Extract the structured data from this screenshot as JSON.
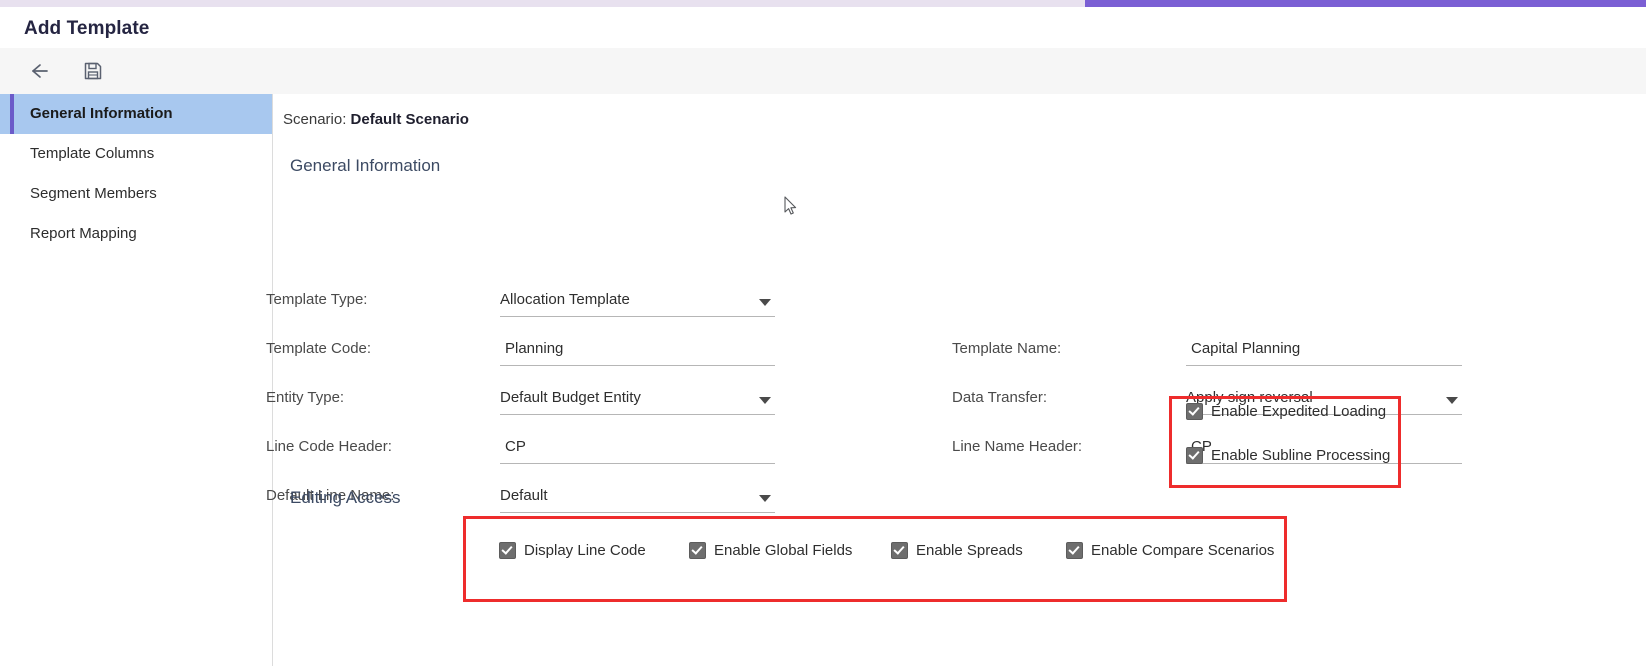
{
  "window": {
    "title": "Add Template",
    "accent_color": "#7b5fd4"
  },
  "toolbar": {
    "back_label": "Back",
    "save_label": "Save",
    "icons": [
      "back-arrow-icon",
      "save-floppy-icon"
    ]
  },
  "sidebar": {
    "items": [
      {
        "label": "General Information",
        "selected": true
      },
      {
        "label": "Template Columns",
        "selected": false
      },
      {
        "label": "Segment Members",
        "selected": false
      },
      {
        "label": "Report Mapping",
        "selected": false
      }
    ],
    "selected_bg": "#a8c8ef",
    "accent_bar": "#6b5bc9"
  },
  "main": {
    "scenario": {
      "label": "Scenario:",
      "value": "Default Scenario"
    },
    "general_information": {
      "heading": "General Information",
      "fields_left": [
        {
          "label": "Template Type:",
          "value": "Allocation Template",
          "type": "dropdown"
        },
        {
          "label": "Template Code:",
          "value": "Planning",
          "type": "text"
        },
        {
          "label": "Entity Type:",
          "value": "Default Budget Entity",
          "type": "dropdown"
        },
        {
          "label": "Line Code Header:",
          "value": "CP",
          "type": "text"
        },
        {
          "label": "Default Line Name:",
          "value": "Default",
          "type": "dropdown"
        }
      ],
      "fields_right": [
        {
          "label": "Template Name:",
          "value": "Capital Planning",
          "type": "text"
        },
        {
          "label": "Data Transfer:",
          "value": "Apply sign reversal",
          "type": "dropdown"
        },
        {
          "label": "Line Name Header:",
          "value": "CP",
          "type": "text"
        }
      ],
      "checkboxes_right": [
        {
          "label": "Enable Expedited Loading",
          "checked": true
        },
        {
          "label": "Enable Subline Processing",
          "checked": true
        }
      ]
    },
    "editing_access": {
      "heading": "Editing Access",
      "checkboxes": [
        {
          "label": "Display Line Code",
          "checked": true
        },
        {
          "label": "Enable Global Fields",
          "checked": true
        },
        {
          "label": "Enable Spreads",
          "checked": true
        },
        {
          "label": "Enable Compare Scenarios",
          "checked": true
        }
      ]
    }
  },
  "annotations": {
    "highlight_color": "#ee2c2c",
    "boxes": [
      "enable-loading-group",
      "editing-access-group"
    ]
  }
}
